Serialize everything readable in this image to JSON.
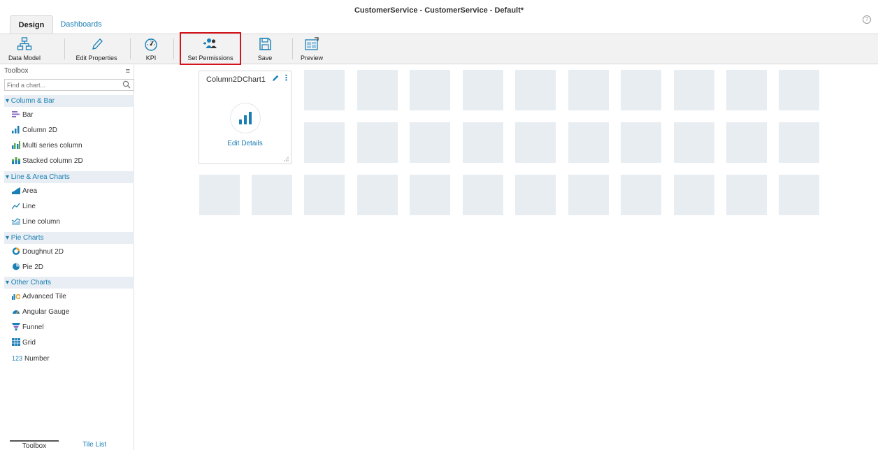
{
  "window": {
    "title": "CustomerService - CustomerService - Default*",
    "help_glyph": "?"
  },
  "tabs": [
    {
      "label": "Design",
      "active": true
    },
    {
      "label": "Dashboards",
      "active": false
    }
  ],
  "ribbon": {
    "buttons": [
      {
        "label": "Data Model",
        "icon": "data-model-icon"
      },
      {
        "label": "Edit Properties",
        "icon": "pencil-icon"
      },
      {
        "label": "KPI",
        "icon": "gauge-icon"
      },
      {
        "label": "Set Permissions",
        "icon": "users-permission-icon",
        "highlighted": true
      },
      {
        "label": "Save",
        "icon": "floppy-disk-icon"
      },
      {
        "label": "Preview",
        "icon": "preview-icon"
      }
    ]
  },
  "toolbox": {
    "title": "Toolbox",
    "search_placeholder": "Find a chart...",
    "categories": [
      {
        "label": "▾ Column & Bar",
        "items": [
          {
            "label": "Bar",
            "icon": "bar-chart-icon"
          },
          {
            "label": "Column 2D",
            "icon": "column-chart-icon"
          },
          {
            "label": "Multi series column",
            "icon": "multi-series-column-icon"
          },
          {
            "label": "Stacked column 2D",
            "icon": "stacked-column-icon"
          }
        ]
      },
      {
        "label": "▾ Line & Area Charts",
        "items": [
          {
            "label": "Area",
            "icon": "area-chart-icon"
          },
          {
            "label": "Line",
            "icon": "line-chart-icon"
          },
          {
            "label": "Line column",
            "icon": "line-column-icon"
          }
        ]
      },
      {
        "label": "▾ Pie Charts",
        "items": [
          {
            "label": "Doughnut 2D",
            "icon": "doughnut-chart-icon"
          },
          {
            "label": "Pie 2D",
            "icon": "pie-chart-icon"
          }
        ]
      },
      {
        "label": "▾ Other Charts",
        "items": [
          {
            "label": "Advanced Tile",
            "icon": "advanced-tile-icon"
          },
          {
            "label": "Angular Gauge",
            "icon": "angular-gauge-icon"
          },
          {
            "label": "Funnel",
            "icon": "funnel-icon"
          },
          {
            "label": "Grid",
            "icon": "grid-icon"
          },
          {
            "label": "Number",
            "icon": "number-icon",
            "prefix": "123"
          }
        ]
      }
    ],
    "bottom_tabs": [
      {
        "label": "Toolbox",
        "active": true
      },
      {
        "label": "Tile List",
        "active": false
      }
    ]
  },
  "canvas": {
    "tile": {
      "title": "Column2DChart1",
      "action": "Edit Details",
      "icon": "column-chart-icon",
      "more_glyph": "⋮"
    }
  },
  "colors": {
    "accent": "#1a7fb5",
    "highlight_border": "#d4141b",
    "placeholder": "#e8edf2",
    "category_bg": "#e8eef3",
    "ribbon_bg": "#f2f2f2"
  }
}
